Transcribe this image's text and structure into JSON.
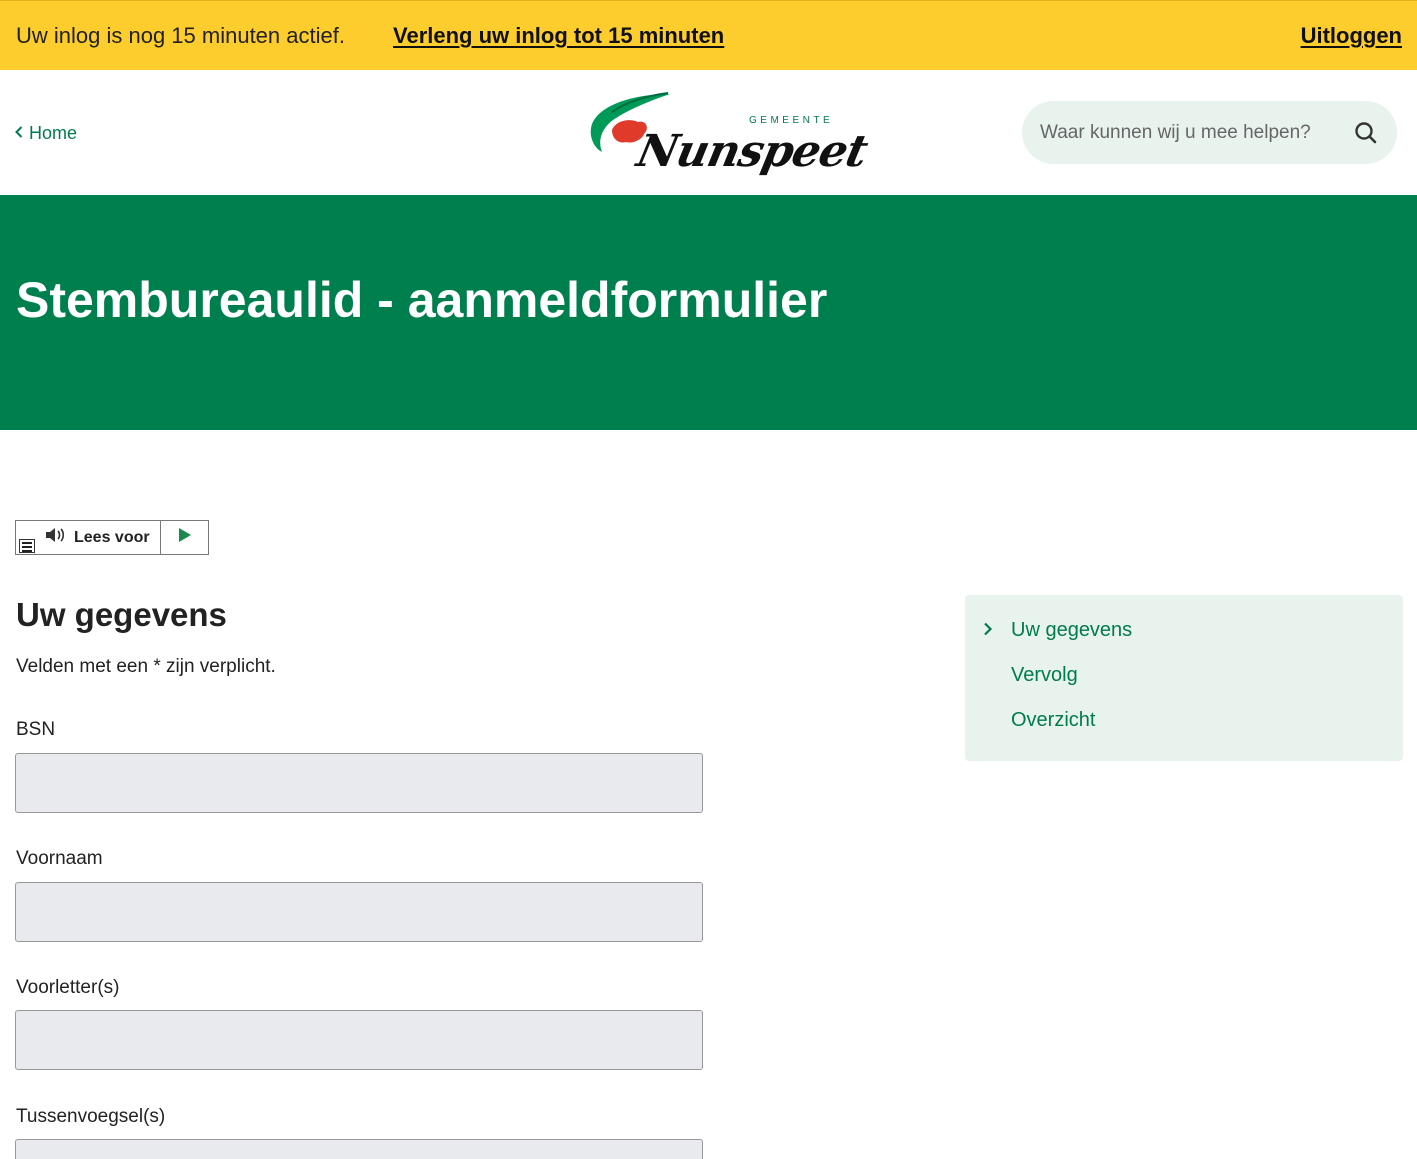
{
  "session": {
    "message": "Uw inlog is nog 15 minuten actief.",
    "extend_label": "Verleng uw inlog tot 15 minuten",
    "logout_label": "Uitloggen"
  },
  "header": {
    "home_label": "Home",
    "logo": {
      "gemeente": "GEMEENTE",
      "name": "Nunspeet"
    },
    "search_placeholder": "Waar kunnen wij u mee helpen?"
  },
  "hero": {
    "title": "Stembureaulid - aanmeldformulier"
  },
  "readspeaker": {
    "label": "Lees voor"
  },
  "form": {
    "title": "Uw gegevens",
    "note": "Velden met een * zijn verplicht.",
    "fields": [
      {
        "label": "BSN",
        "value": ""
      },
      {
        "label": "Voornaam",
        "value": ""
      },
      {
        "label": "Voorletter(s)",
        "value": ""
      },
      {
        "label": "Tussenvoegsel(s)",
        "value": ""
      }
    ]
  },
  "steps": {
    "items": [
      {
        "label": "Uw gegevens",
        "active": true
      },
      {
        "label": "Vervolg",
        "active": false
      },
      {
        "label": "Overzicht",
        "active": false
      }
    ]
  },
  "colors": {
    "session_bar": "#fdcd2e",
    "brand_green": "#007f4e",
    "logo_red": "#e03a2a",
    "field_bg": "#e8eaed",
    "nav_bg": "#e9f3ee"
  }
}
